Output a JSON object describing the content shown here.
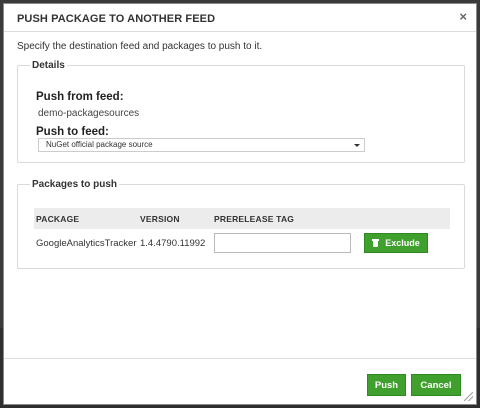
{
  "dialog": {
    "title": "PUSH PACKAGE TO ANOTHER FEED",
    "close_icon": "×",
    "intro": "Specify the destination feed and packages to push to it."
  },
  "details": {
    "legend": "Details",
    "push_from_label": "Push from feed:",
    "push_from_value": "demo-packagesources",
    "push_to_label": "Push to feed:",
    "push_to_selected": "NuGet official package source"
  },
  "packages": {
    "legend": "Packages to push",
    "columns": [
      "PACKAGE",
      "VERSION",
      "PRERELEASE TAG"
    ],
    "rows": [
      {
        "package": "GoogleAnalyticsTracker",
        "version": "1.4.4790.11992",
        "prerelease_tag": "",
        "exclude_label": "Exclude"
      }
    ]
  },
  "footer": {
    "push_label": "Push",
    "cancel_label": "Cancel"
  },
  "colors": {
    "accent_green": "#3fa02e",
    "header_bg": "#ececec"
  },
  "icons": {
    "close": "close-icon",
    "exclude": "trash-icon",
    "select": "chevron-down-icon",
    "resize": "resize-grip-icon"
  }
}
